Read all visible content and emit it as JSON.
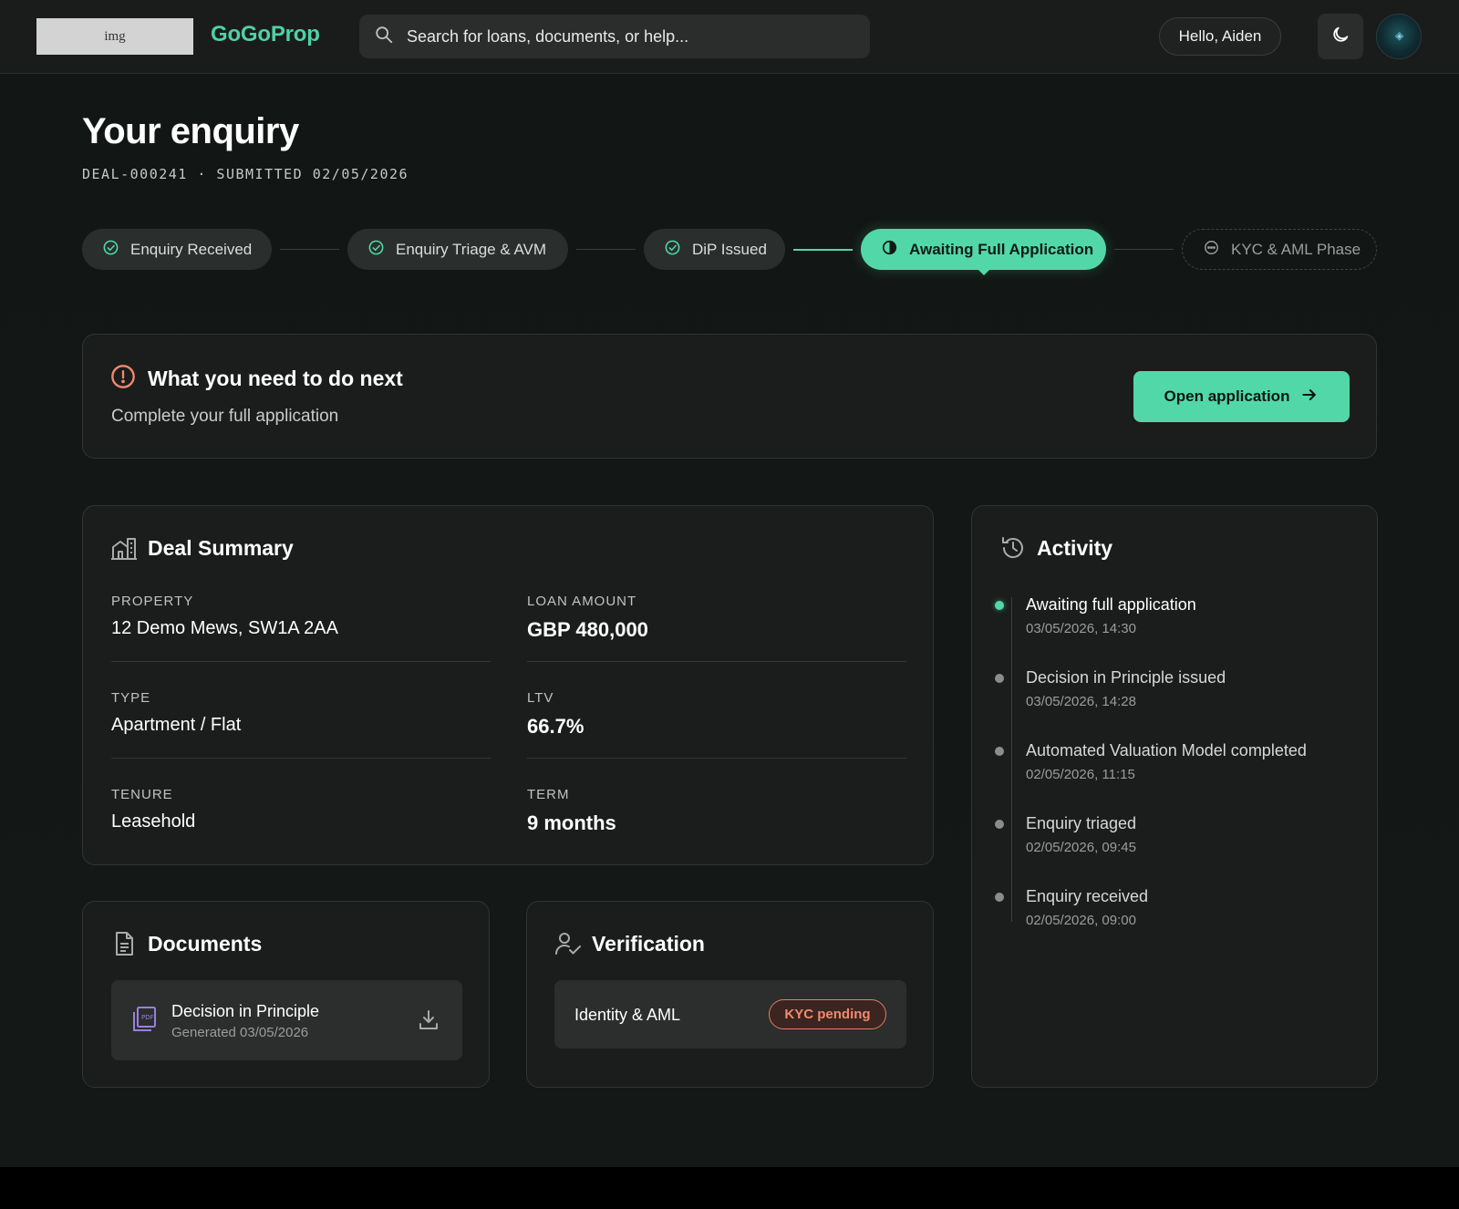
{
  "header": {
    "logo_placeholder": "img",
    "brand": "GoGoProp",
    "search_placeholder": "Search for loans, documents, or help...",
    "greeting": "Hello, Aiden"
  },
  "page": {
    "title": "Your enquiry",
    "subtitle": "DEAL-000241 · SUBMITTED 02/05/2026"
  },
  "stepper": [
    {
      "label": "Enquiry Received",
      "status": "done"
    },
    {
      "label": "Enquiry Triage & AVM",
      "status": "done"
    },
    {
      "label": "DiP Issued",
      "status": "done"
    },
    {
      "label": "Awaiting Full Application",
      "status": "active"
    },
    {
      "label": "KYC & AML Phase",
      "status": "pending"
    }
  ],
  "next_step": {
    "title": "What you need to do next",
    "description": "Complete your full application",
    "button_label": "Open application"
  },
  "deal_summary": {
    "title": "Deal Summary",
    "fields": [
      {
        "label": "PROPERTY",
        "value": "12 Demo Mews, SW1A 2AA"
      },
      {
        "label": "LOAN AMOUNT",
        "value": "GBP 480,000"
      },
      {
        "label": "TYPE",
        "value": "Apartment / Flat"
      },
      {
        "label": "LTV",
        "value": "66.7%"
      },
      {
        "label": "TENURE",
        "value": "Leasehold"
      },
      {
        "label": "TERM",
        "value": "9 months"
      }
    ]
  },
  "documents": {
    "title": "Documents",
    "items": [
      {
        "name": "Decision in Principle",
        "date": "Generated 03/05/2026"
      }
    ]
  },
  "verification": {
    "title": "Verification",
    "label": "Identity & AML",
    "status": "KYC pending"
  },
  "activity": {
    "title": "Activity",
    "items": [
      {
        "title": "Awaiting full application",
        "time": "03/05/2026, 14:30"
      },
      {
        "title": "Decision in Principle issued",
        "time": "03/05/2026, 14:28"
      },
      {
        "title": "Automated Valuation Model completed",
        "time": "02/05/2026, 11:15"
      },
      {
        "title": "Enquiry triaged",
        "time": "02/05/2026, 09:45"
      },
      {
        "title": "Enquiry received",
        "time": "02/05/2026, 09:00"
      }
    ]
  },
  "colors": {
    "accent": "#52d8a8",
    "brand": "#4fd1a5",
    "warning": "#f08a70",
    "background": "#141816",
    "card": "#1b1d1c"
  }
}
